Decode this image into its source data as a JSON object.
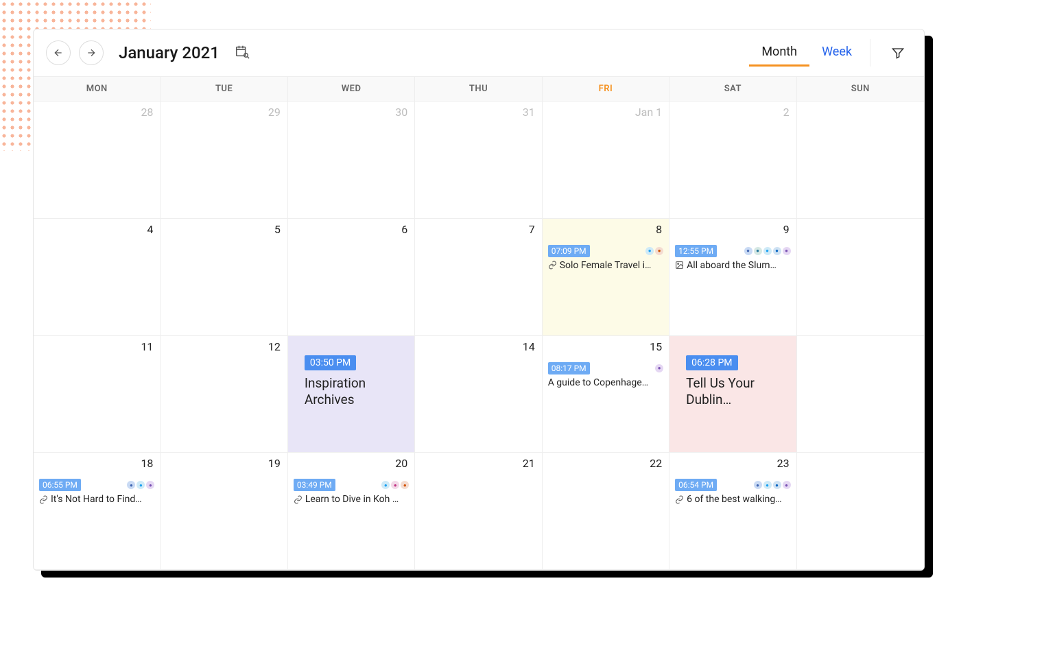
{
  "header": {
    "title": "January 2021",
    "tabs": {
      "month": "Month",
      "week": "Week",
      "active": "month"
    }
  },
  "dow": [
    "MON",
    "TUE",
    "WED",
    "THU",
    "FRI",
    "SAT",
    "SUN"
  ],
  "todayIndex": 4,
  "weeks": [
    [
      {
        "label": "28",
        "muted": true
      },
      {
        "label": "29",
        "muted": true
      },
      {
        "label": "30",
        "muted": true
      },
      {
        "label": "31",
        "muted": true
      },
      {
        "label": "Jan 1",
        "muted": true
      },
      {
        "label": "2",
        "muted": true
      },
      {
        "label": ""
      }
    ],
    [
      {
        "label": "4"
      },
      {
        "label": "5"
      },
      {
        "label": "6"
      },
      {
        "label": "7"
      },
      {
        "label": "8",
        "bg": "yellow",
        "event": {
          "type": "small",
          "time": "07:09 PM",
          "titleIcon": "link",
          "title": "Solo Female Travel i…",
          "nets": [
            "tw",
            "gs"
          ]
        }
      },
      {
        "label": "9",
        "event": {
          "type": "small",
          "time": "12:55 PM",
          "titleIcon": "image",
          "title": "All aboard the Slum…",
          "nets": [
            "fb",
            "wp",
            "tw",
            "li",
            "gb"
          ]
        }
      },
      {
        "label": ""
      }
    ],
    [
      {
        "label": "11"
      },
      {
        "label": "12"
      },
      {
        "label": "",
        "bg": "purple",
        "event": {
          "type": "big",
          "time": "03:50 PM",
          "title": "Inspiration Archives"
        }
      },
      {
        "label": "14"
      },
      {
        "label": "15",
        "event": {
          "type": "small",
          "time": "08:17 PM",
          "titleIcon": "",
          "title": "A guide to Copenhage…",
          "nets": [
            "gb"
          ]
        }
      },
      {
        "label": "",
        "bg": "pink",
        "event": {
          "type": "big",
          "time": "06:28 PM",
          "title": "Tell Us Your Dublin…"
        }
      },
      {
        "label": ""
      }
    ],
    [
      {
        "label": "18",
        "event": {
          "type": "small",
          "time": "06:55 PM",
          "titleIcon": "link",
          "title": "It's Not Hard to Find…",
          "nets": [
            "fb",
            "tw",
            "gb"
          ]
        }
      },
      {
        "label": "19"
      },
      {
        "label": "20",
        "event": {
          "type": "small",
          "time": "03:49 PM",
          "titleIcon": "link",
          "title": "Learn to Dive in Koh …",
          "nets": [
            "tw",
            "ig",
            "gs"
          ]
        }
      },
      {
        "label": "21"
      },
      {
        "label": "22"
      },
      {
        "label": "23",
        "event": {
          "type": "small",
          "time": "06:54 PM",
          "titleIcon": "link",
          "title": "6 of the best walking…",
          "nets": [
            "fb",
            "tw",
            "li",
            "gb"
          ]
        }
      },
      {
        "label": ""
      }
    ]
  ]
}
